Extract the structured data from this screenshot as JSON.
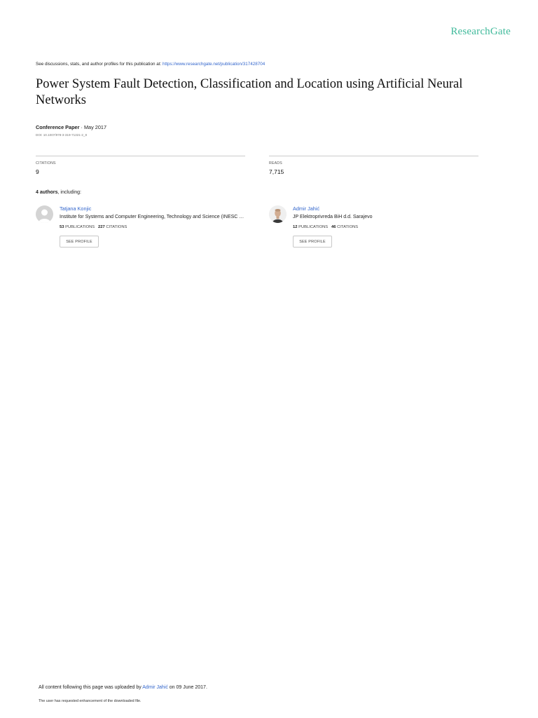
{
  "brand": "ResearchGate",
  "header": {
    "discussion_prefix": "See discussions, stats, and author profiles for this publication at: ",
    "publication_url": "https://www.researchgate.net/publication/317428704"
  },
  "paper": {
    "title": "Power System Fault Detection, Classification and Location using Artificial Neural Networks",
    "type": "Conference Paper",
    "date_sep": " · ",
    "date": "May 2017",
    "doi": "DOI: 10.1007/978-3-319-71321-2_8"
  },
  "stats": {
    "citations_label": "CITATIONS",
    "citations_value": "9",
    "reads_label": "READS",
    "reads_value": "7,715"
  },
  "authors_section": {
    "count_label": "4 authors",
    "suffix": ", including:"
  },
  "authors": [
    {
      "name": "Tatjana Konjic",
      "institution": "Institute for Systems and Computer Engineering, Technology and Science (INESC …",
      "publications": "53",
      "publications_label": "PUBLICATIONS",
      "citations": "227",
      "citations_label": "CITATIONS",
      "button": "SEE PROFILE"
    },
    {
      "name": "Admir Jahić",
      "institution": "JP Elektroprivreda BiH d.d. Sarajevo",
      "publications": "12",
      "publications_label": "PUBLICATIONS",
      "citations": "46",
      "citations_label": "CITATIONS",
      "button": "SEE PROFILE"
    }
  ],
  "footer": {
    "upload_prefix": "All content following this page was uploaded by ",
    "uploader": "Admir Jahić",
    "upload_suffix": " on 09 June 2017.",
    "enhancement_note": "The user has requested enhancement of the downloaded file."
  }
}
